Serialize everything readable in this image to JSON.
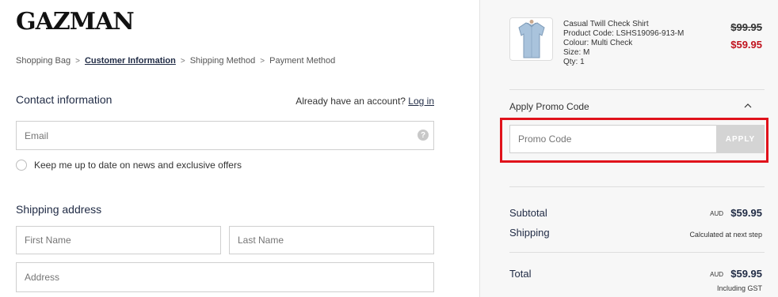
{
  "brand": {
    "logo_text": "GAZMAN"
  },
  "breadcrumb": {
    "items": [
      "Shopping Bag",
      "Customer Information",
      "Shipping Method",
      "Payment Method"
    ],
    "separator": ">"
  },
  "contact": {
    "heading": "Contact information",
    "have_account_text": "Already have an account?",
    "login_link": "Log in",
    "email_placeholder": "Email",
    "newsletter_label": "Keep me up to date on news and exclusive offers"
  },
  "shipping": {
    "heading": "Shipping address",
    "first_name_placeholder": "First Name",
    "last_name_placeholder": "Last Name",
    "address_placeholder": "Address"
  },
  "order": {
    "product": {
      "name": "Casual Twill Check Shirt",
      "code": "Product Code: LSHS19096-913-M",
      "colour": "Colour: Multi Check",
      "size": "Size: M",
      "qty": "Qty: 1",
      "price_original": "$99.95",
      "price_sale": "$59.95"
    },
    "promo": {
      "title": "Apply Promo Code",
      "placeholder": "Promo Code",
      "apply_label": "APPLY"
    },
    "summary": {
      "subtotal_label": "Subtotal",
      "subtotal_currency": "AUD",
      "subtotal_value": "$59.95",
      "shipping_label": "Shipping",
      "shipping_value": "Calculated at next step",
      "total_label": "Total",
      "total_currency": "AUD",
      "total_value": "$59.95",
      "total_note": "Including GST"
    }
  },
  "colors": {
    "accent": "#1f2a44",
    "sale": "#c0121d",
    "highlight": "#e0121b"
  }
}
